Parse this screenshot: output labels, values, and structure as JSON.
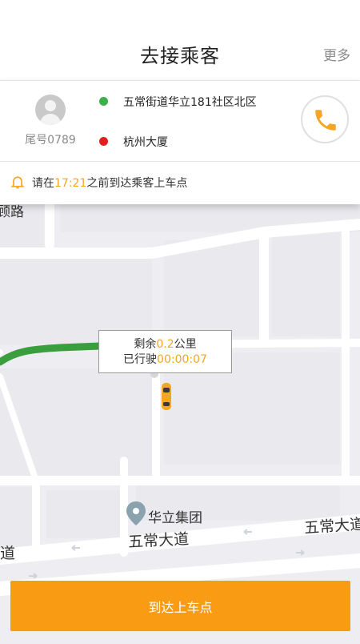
{
  "header": {
    "title": "去接乘客",
    "more": "更多"
  },
  "passenger": {
    "tail_number": "尾号0789"
  },
  "route": {
    "pickup": "五常街道华立181社区北区",
    "destination": "杭州大厦",
    "pickup_dot_color": "#3bb14a",
    "destination_dot_color": "#e02020"
  },
  "phone": {
    "icon": "phone-icon",
    "color": "#f5a623"
  },
  "notice": {
    "icon": "bell-icon",
    "prefix": "请在",
    "time": "17:21",
    "suffix": "之前到达乘客上车点"
  },
  "map": {
    "remaining_prefix": "剩余",
    "remaining_value": "0.2",
    "remaining_unit": "公里",
    "driven_prefix": "已行驶",
    "driven_time": "00:00:07",
    "poi": "华立集团",
    "road_labels": [
      "顾路",
      "五常大道",
      "五常大道",
      "道"
    ],
    "route_color": "#3b9e3e",
    "car_color": "#f5a623"
  },
  "actions": {
    "arrive": "到达上车点"
  },
  "colors": {
    "accent": "#f5a623",
    "button": "#fa9c13"
  }
}
